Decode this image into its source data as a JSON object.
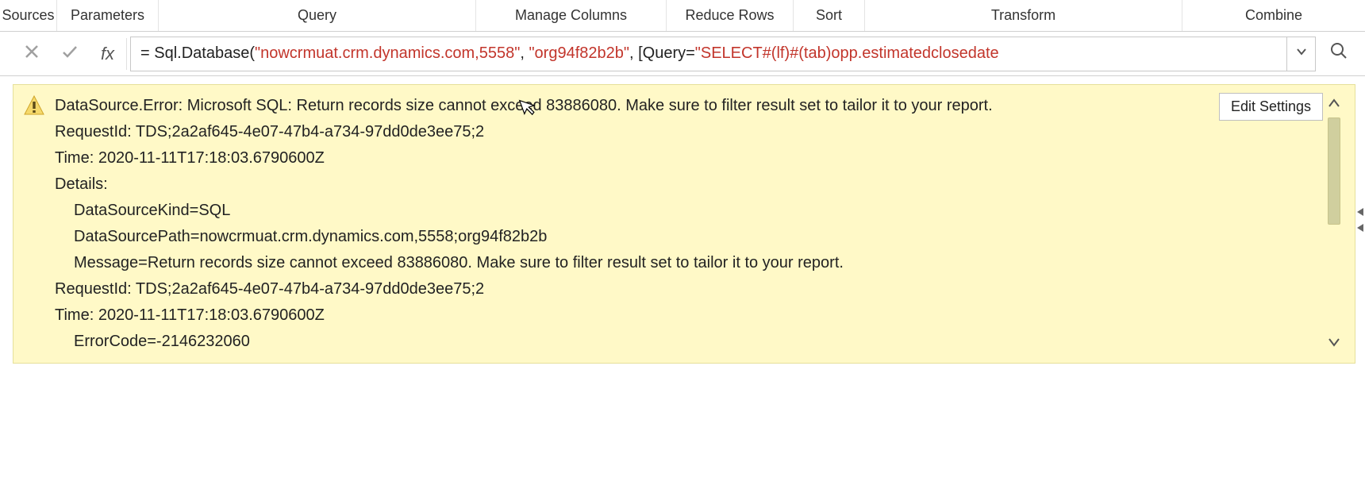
{
  "ribbon": {
    "sources": "Sources",
    "parameters": "Parameters",
    "query": "Query",
    "manage_columns": "Manage Columns",
    "reduce_rows": "Reduce Rows",
    "sort": "Sort",
    "transform": "Transform",
    "combine": "Combine"
  },
  "formula_bar": {
    "fx_label": "fx",
    "eq": "= ",
    "func": "Sql.Database(",
    "str_server": "\"nowcrmuat.crm.dynamics.com,5558\"",
    "comma1": ", ",
    "str_db": "\"org94f82b2b\"",
    "comma2": ", [Query=",
    "str_query": "\"SELECT#(lf)#(tab)opp.estimatedclosedate"
  },
  "error_panel": {
    "edit_settings_label": "Edit Settings",
    "lines": {
      "l0": "DataSource.Error: Microsoft SQL: Return records size cannot exceed 83886080. Make sure to filter result set to tailor it to your report.",
      "l1": "RequestId: TDS;2a2af645-4e07-47b4-a734-97dd0de3ee75;2",
      "l2": "Time: 2020-11-11T17:18:03.6790600Z",
      "l3": "Details:",
      "l4": "DataSourceKind=SQL",
      "l5": "DataSourcePath=nowcrmuat.crm.dynamics.com,5558;org94f82b2b",
      "l6": "Message=Return records size cannot exceed 83886080. Make sure to filter result set to tailor it to your report.",
      "l7": "RequestId: TDS;2a2af645-4e07-47b4-a734-97dd0de3ee75;2",
      "l8": "Time: 2020-11-11T17:18:03.6790600Z",
      "l9": "ErrorCode=-2146232060"
    }
  }
}
